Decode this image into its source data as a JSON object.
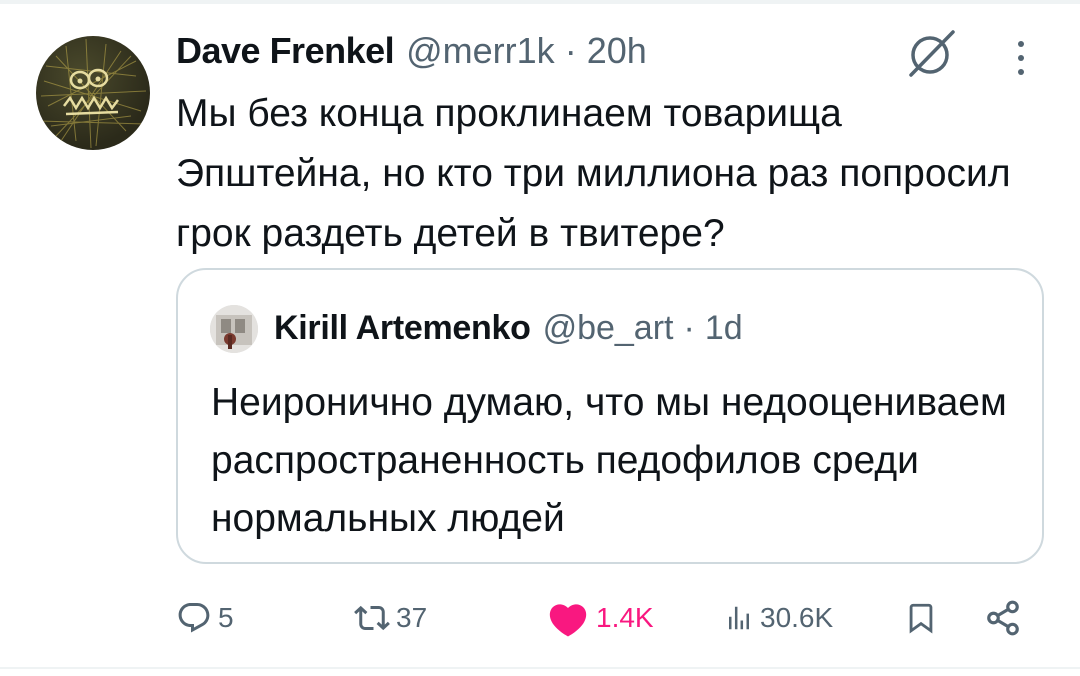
{
  "tweet": {
    "author_name": "Dave Frenkel",
    "author_handle": "@merr1k",
    "separator": "·",
    "time": "20h",
    "text": "Мы без конца проклинаем товарища Эпштейна, но кто три миллиона раз попросил грок раздеть детей в твитере?"
  },
  "quote": {
    "author_name": "Kirill Artemenko",
    "author_handle": "@be_art",
    "separator": "·",
    "time": "1d",
    "text": "Неиронично думаю, что мы недооцениваем распространенность педофилов среди нормальных людей"
  },
  "actions": {
    "replies": "5",
    "reposts": "37",
    "likes": "1.4K",
    "views": "30.6K"
  },
  "icons": {
    "grok": "grok-icon",
    "more": "more-vertical-icon",
    "reply": "reply-icon",
    "repost": "repost-icon",
    "like": "heart-filled-icon",
    "views": "views-icon",
    "bookmark": "bookmark-icon",
    "share": "share-icon"
  },
  "colors": {
    "text": "#0f1419",
    "secondary": "#536471",
    "like_active": "#f91880",
    "border": "#cfd9de"
  }
}
